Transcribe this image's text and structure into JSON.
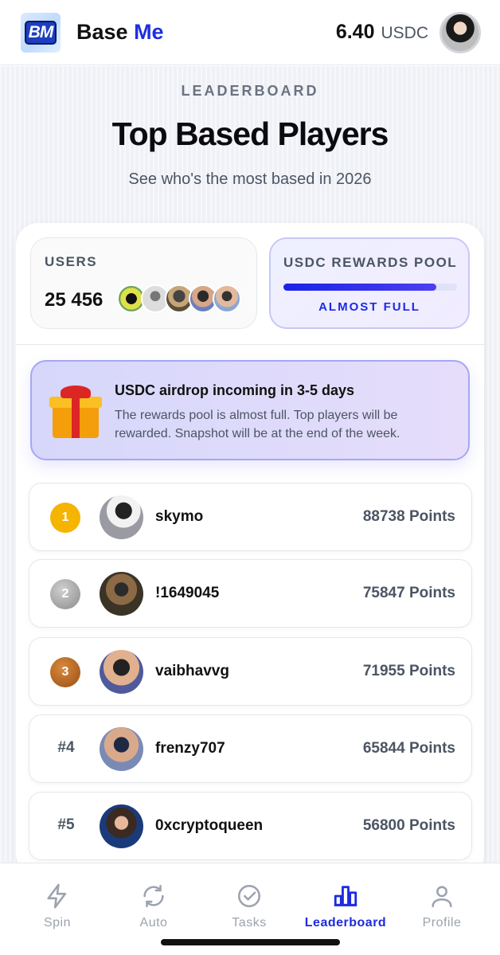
{
  "header": {
    "logo_text": "BM",
    "brand_name": "Base",
    "brand_accent": "Me",
    "balance_amount": "6.40",
    "balance_unit": "USDC"
  },
  "hero": {
    "eyebrow": "LEADERBOARD",
    "title": "Top Based Players",
    "subtitle": "See who's the most based in 2026"
  },
  "stats": {
    "users_label": "USERS",
    "users_count": "25 456",
    "pool_label": "USDC REWARDS POOL",
    "pool_fill_percent": 88,
    "pool_status": "ALMOST FULL"
  },
  "airdrop": {
    "title": "USDC airdrop incoming in 3-5 days",
    "body": "The rewards pool is almost full. Top players will be rewarded. Snapshot will be at the end of the week."
  },
  "leaderboard": [
    {
      "rank": "1",
      "name": "skymo",
      "points": "88738 Points"
    },
    {
      "rank": "2",
      "name": "!1649045",
      "points": "75847 Points"
    },
    {
      "rank": "3",
      "name": "vaibhavvg",
      "points": "71955 Points"
    },
    {
      "rank": "#4",
      "name": "frenzy707",
      "points": "65844 Points"
    },
    {
      "rank": "#5",
      "name": "0xcryptoqueen",
      "points": "56800 Points"
    }
  ],
  "nav": [
    {
      "label": "Spin",
      "icon": "lightning-icon"
    },
    {
      "label": "Auto",
      "icon": "refresh-icon"
    },
    {
      "label": "Tasks",
      "icon": "check-circle-icon"
    },
    {
      "label": "Leaderboard",
      "icon": "bar-chart-icon"
    },
    {
      "label": "Profile",
      "icon": "person-icon"
    }
  ],
  "colors": {
    "accent": "#1d2be0",
    "gold": "#f5b400",
    "silver": "#9e9e9e",
    "bronze": "#b5651d"
  }
}
